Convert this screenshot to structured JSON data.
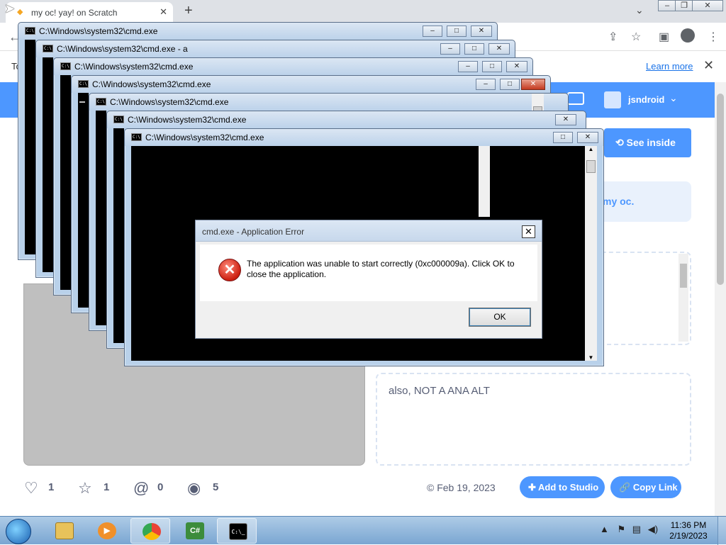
{
  "browser": {
    "tab_title": "my oc! yay! on Scratch",
    "tab_close": "✕",
    "new_tab": "+",
    "infobar_prefix": "To",
    "learn_more": "Learn more",
    "infobar_close": "✕"
  },
  "scratch": {
    "username": "jsndroid",
    "see_inside": "See inside",
    "notes_fragment": "my oc.",
    "notes_credits": "also, NOT A ANA ALT",
    "stats": {
      "loves": "1",
      "favorites": "1",
      "remixes": "0",
      "views": "5"
    },
    "date": "© Feb 19, 2023",
    "add_to_studio": "Add to Studio",
    "copy_link": "Copy Link"
  },
  "cmd_windows": [
    {
      "title": "C:\\Windows\\system32\\cmd.exe"
    },
    {
      "title": "C:\\Windows\\system32\\cmd.exe - a"
    },
    {
      "title": "C:\\Windows\\system32\\cmd.exe"
    },
    {
      "title": "C:\\Windows\\system32\\cmd.exe"
    },
    {
      "title": "C:\\Windows\\system32\\cmd.exe"
    },
    {
      "title": "C:\\Windows\\system32\\cmd.exe"
    },
    {
      "title": "C:\\Windows\\system32\\cmd.exe"
    }
  ],
  "cmd_icon_text": "C:\\",
  "dialog": {
    "title": "cmd.exe - Application Error",
    "message": "The application was unable to start correctly (0xc000009a). Click OK to close the application.",
    "ok": "OK",
    "close": "✕"
  },
  "taskbar": {
    "apps": [
      "explorer",
      "media-player",
      "chrome",
      "csharp",
      "cmd"
    ],
    "csharp_label": "C#",
    "cmd_label": "C:\\_",
    "time": "11:36 PM",
    "date": "2/19/2023"
  },
  "colors": {
    "scratch_blue": "#4d97ff",
    "cmd_frame": "#b9d1ea",
    "taskbar": "#7aa6d2"
  }
}
